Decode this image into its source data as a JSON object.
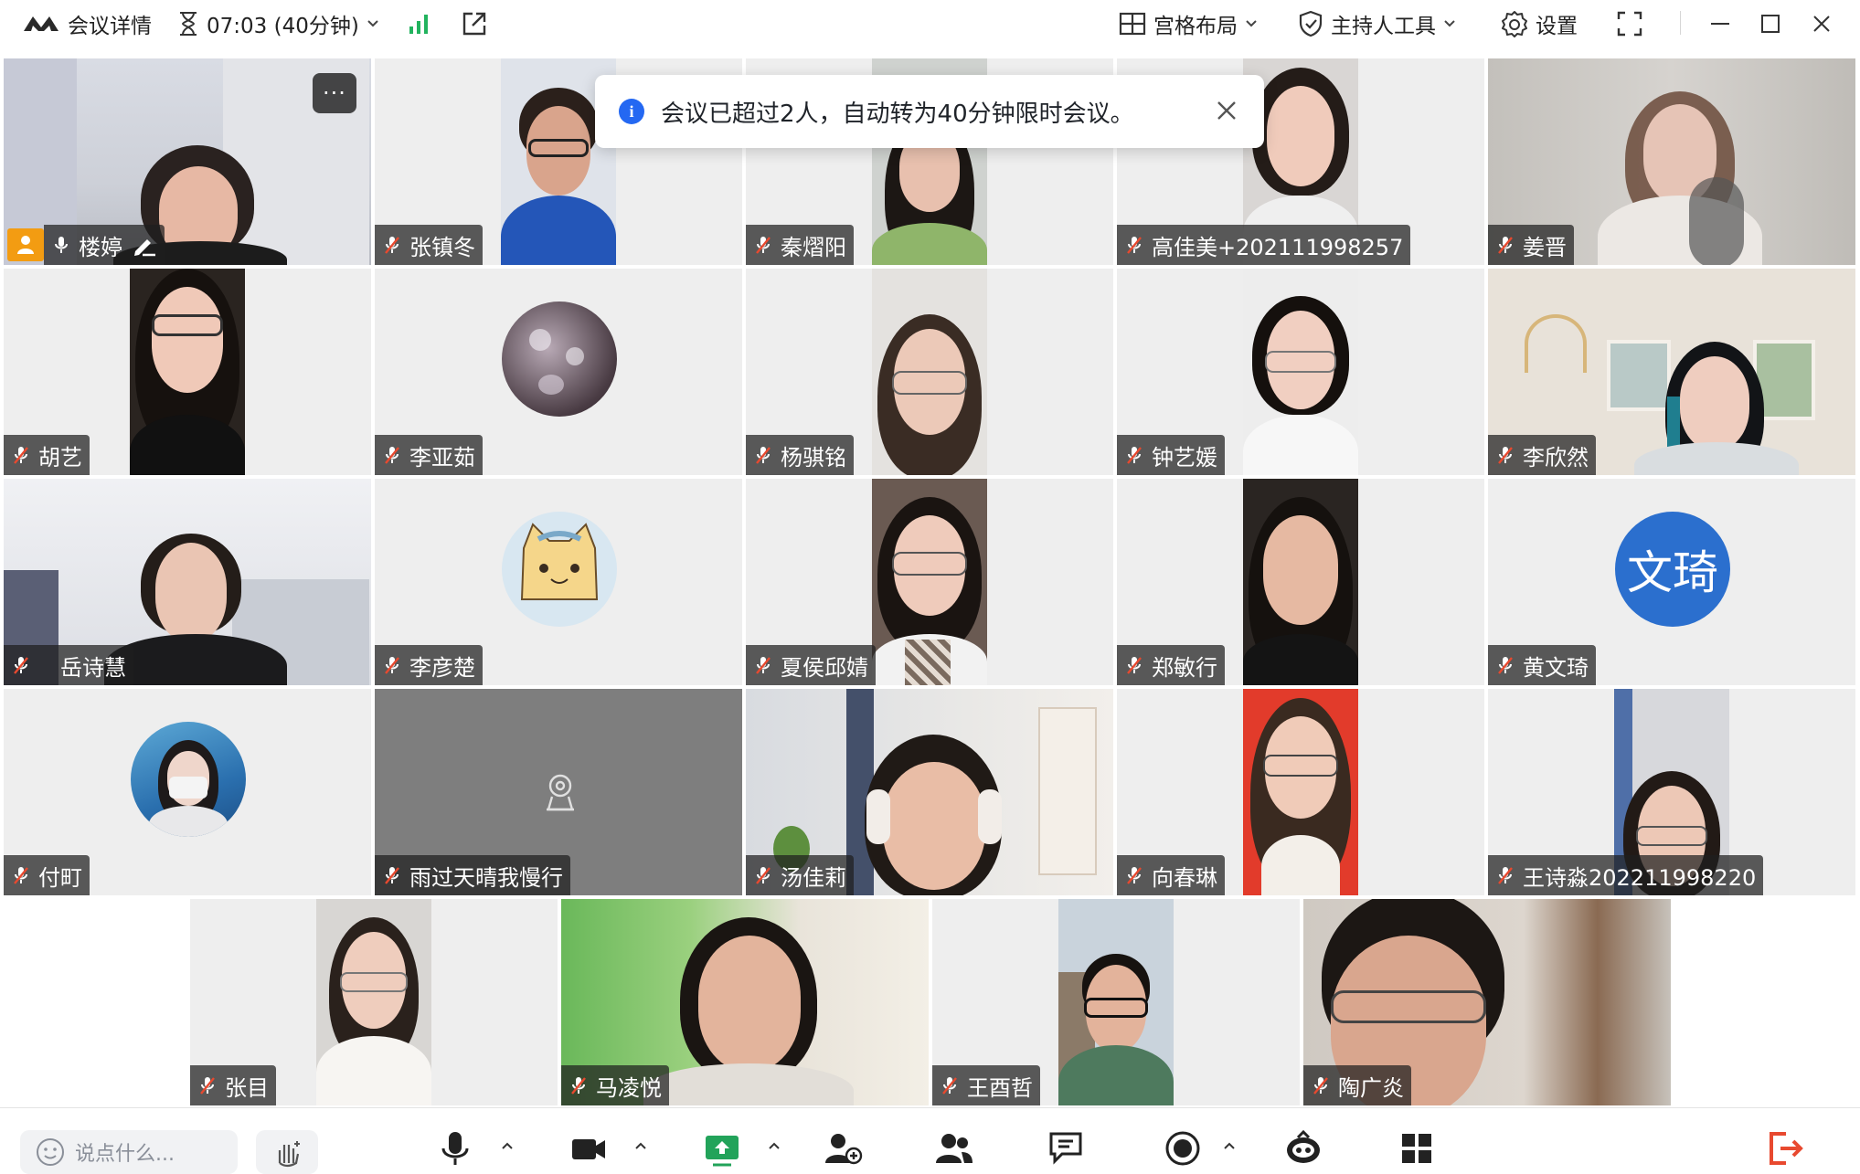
{
  "topbar": {
    "meeting_details": "会议详情",
    "timer": "07:03 (40分钟)",
    "layout": "宫格布局",
    "host_tools": "主持人工具",
    "settings": "设置"
  },
  "toast": {
    "message": "会议已超过2人，自动转为40分钟限时会议。"
  },
  "participants": [
    {
      "name": "楼婷"
    },
    {
      "name": "张镇冬"
    },
    {
      "name": "秦熠阳"
    },
    {
      "name": "高佳美+202111998257"
    },
    {
      "name": "姜晋"
    },
    {
      "name": "胡艺"
    },
    {
      "name": "李亚茹"
    },
    {
      "name": "杨骐铭"
    },
    {
      "name": "钟艺媛"
    },
    {
      "name": "李欣然"
    },
    {
      "name": "岳诗慧"
    },
    {
      "name": "李彦楚"
    },
    {
      "name": "夏侯邱婧"
    },
    {
      "name": "郑敏行"
    },
    {
      "name": "黄文琦",
      "avatar_text": "文琦"
    },
    {
      "name": "付町"
    },
    {
      "name": "雨过天晴我慢行"
    },
    {
      "name": "汤佳莉"
    },
    {
      "name": "向春琳"
    },
    {
      "name": "王诗淼202211998220"
    },
    {
      "name": "张目"
    },
    {
      "name": "马凌悦"
    },
    {
      "name": "王酉哲"
    },
    {
      "name": "陶广炎"
    }
  ],
  "bottombar": {
    "chat_placeholder": "说点什么..."
  },
  "colors": {
    "accent_blue": "#2468f2",
    "host_badge": "#f39c12",
    "leave_red": "#e8492f",
    "tile_bg": "#eeeeee"
  }
}
